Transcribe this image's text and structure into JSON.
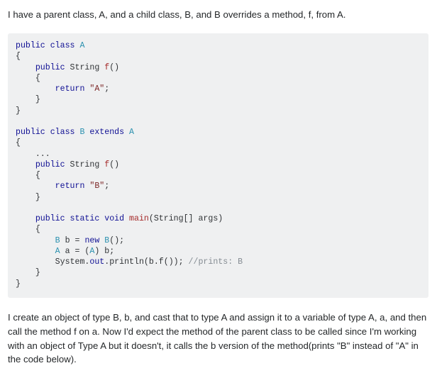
{
  "question": {
    "intro": "I have a parent class, A, and a child class, B, and B overrides a method, f, from A.",
    "explanation": "I create an object of type B, b, and cast that to type A and assign it to a variable of type A, a, and then call the method f on a. Now I'd expect the method of the parent class to be called since I'm working with an object of Type A but it doesn't, it calls the b version of the method(prints \"B\" instead of \"A\" in the code below)."
  },
  "code": {
    "lines": [
      [
        {
          "t": "public class ",
          "c": "kw"
        },
        {
          "t": "A",
          "c": "typ"
        }
      ],
      [
        {
          "t": "{",
          "c": "pun"
        }
      ],
      [
        {
          "t": "    ",
          "c": "pln"
        },
        {
          "t": "public ",
          "c": "kw"
        },
        {
          "t": "String ",
          "c": "pln"
        },
        {
          "t": "f",
          "c": "fn"
        },
        {
          "t": "()",
          "c": "pun"
        }
      ],
      [
        {
          "t": "    {",
          "c": "pun"
        }
      ],
      [
        {
          "t": "        ",
          "c": "pln"
        },
        {
          "t": "return ",
          "c": "kw"
        },
        {
          "t": "\"A\"",
          "c": "str"
        },
        {
          "t": ";",
          "c": "pun"
        }
      ],
      [
        {
          "t": "    }",
          "c": "pun"
        }
      ],
      [
        {
          "t": "}",
          "c": "pun"
        }
      ],
      [],
      [
        {
          "t": "public class ",
          "c": "kw"
        },
        {
          "t": "B ",
          "c": "typ"
        },
        {
          "t": "extends ",
          "c": "kw"
        },
        {
          "t": "A",
          "c": "typ"
        }
      ],
      [
        {
          "t": "{",
          "c": "pun"
        }
      ],
      [
        {
          "t": "    ...",
          "c": "pun"
        }
      ],
      [
        {
          "t": "    ",
          "c": "pln"
        },
        {
          "t": "public ",
          "c": "kw"
        },
        {
          "t": "String ",
          "c": "pln"
        },
        {
          "t": "f",
          "c": "fn"
        },
        {
          "t": "()",
          "c": "pun"
        }
      ],
      [
        {
          "t": "    {",
          "c": "pun"
        }
      ],
      [
        {
          "t": "        ",
          "c": "pln"
        },
        {
          "t": "return ",
          "c": "kw"
        },
        {
          "t": "\"B\"",
          "c": "str"
        },
        {
          "t": ";",
          "c": "pun"
        }
      ],
      [
        {
          "t": "    }",
          "c": "pun"
        }
      ],
      [],
      [
        {
          "t": "    ",
          "c": "pln"
        },
        {
          "t": "public static void ",
          "c": "kw"
        },
        {
          "t": "main",
          "c": "fn"
        },
        {
          "t": "(String[] args)",
          "c": "pun"
        }
      ],
      [
        {
          "t": "    {",
          "c": "pun"
        }
      ],
      [
        {
          "t": "        ",
          "c": "pln"
        },
        {
          "t": "B ",
          "c": "typ"
        },
        {
          "t": "b = ",
          "c": "pln"
        },
        {
          "t": "new ",
          "c": "kw"
        },
        {
          "t": "B",
          "c": "typ"
        },
        {
          "t": "();",
          "c": "pun"
        }
      ],
      [
        {
          "t": "        ",
          "c": "pln"
        },
        {
          "t": "A ",
          "c": "typ"
        },
        {
          "t": "a = (",
          "c": "pln"
        },
        {
          "t": "A",
          "c": "typ"
        },
        {
          "t": ") b;",
          "c": "pun"
        }
      ],
      [
        {
          "t": "        System.",
          "c": "pln"
        },
        {
          "t": "out",
          "c": "kw"
        },
        {
          "t": ".println(b.f()); ",
          "c": "pln"
        },
        {
          "t": "//prints: B",
          "c": "com"
        }
      ],
      [
        {
          "t": "    }",
          "c": "pun"
        }
      ],
      [
        {
          "t": "}",
          "c": "pun"
        }
      ]
    ]
  }
}
